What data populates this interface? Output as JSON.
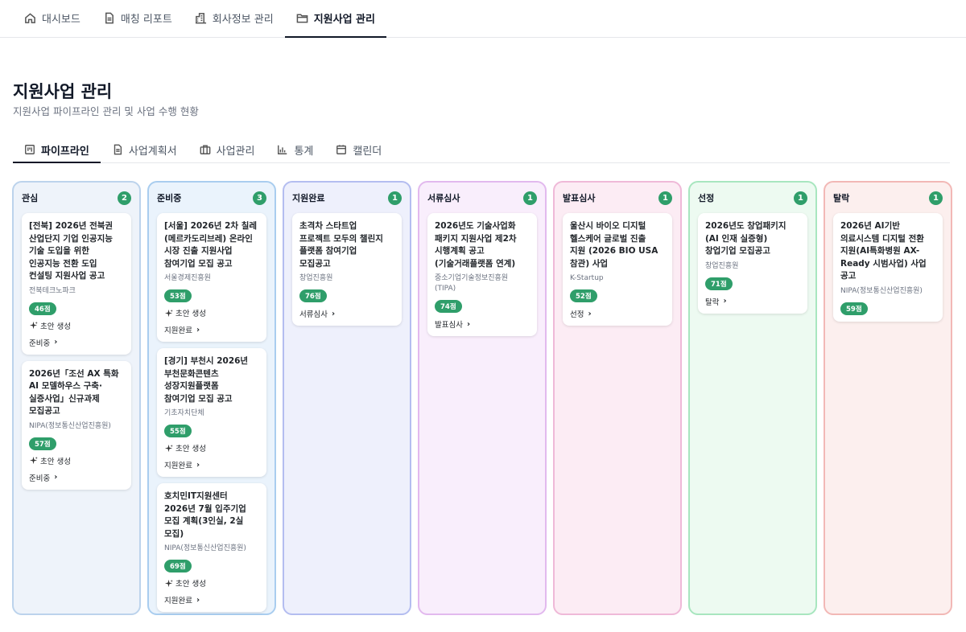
{
  "topnav": {
    "tabs": [
      {
        "label": "대시보드",
        "icon": "home-icon"
      },
      {
        "label": "매칭 리포트",
        "icon": "document-icon"
      },
      {
        "label": "회사정보 관리",
        "icon": "building-icon"
      },
      {
        "label": "지원사업 관리",
        "icon": "folder-icon",
        "active": true
      }
    ]
  },
  "page": {
    "title": "지원사업 관리",
    "subtitle": "지원사업 파이프라인 관리 및 사업 수행 현황"
  },
  "subtabs": [
    {
      "label": "파이프라인",
      "icon": "kanban-icon",
      "active": true
    },
    {
      "label": "사업계획서",
      "icon": "document-icon"
    },
    {
      "label": "사업관리",
      "icon": "briefcase-icon"
    },
    {
      "label": "통계",
      "icon": "bar-chart-icon"
    },
    {
      "label": "캘린더",
      "icon": "calendar-icon"
    }
  ],
  "colors": {
    "accent": "#2f9e6a"
  },
  "columns": [
    {
      "title": "관심",
      "count": "2",
      "border": "#bcd3ec",
      "bg": "#eef3fa",
      "cards": [
        {
          "title": "[전북] 2026년 전북권\n산업단지 기업 인공지능\n기술 도입을 위한\n인공지능 전환 도입\n컨설팅 지원사업 공고",
          "org": "전북테크노파크",
          "score": "46점",
          "draft": "초안 생성",
          "move": "준비중"
        },
        {
          "title": "2026년「조선 AX 특화\nAI 모델하우스 구축·\n실증사업」신규과제\n모집공고",
          "org": "NIPA(정보통신산업진흥원)",
          "score": "57점",
          "draft": "초안 생성",
          "move": "준비중"
        }
      ]
    },
    {
      "title": "준비중",
      "count": "3",
      "border": "#a9cdef",
      "bg": "#eaf3fc",
      "cards": [
        {
          "title": "[서울] 2026년 2차 칠레\n(메르카도리브레) 온라인\n시장 진출 지원사업\n참여기업 모집 공고",
          "org": "서울경제진흥원",
          "score": "53점",
          "draft": "초안 생성",
          "move": "지원완료"
        },
        {
          "title": "[경기] 부천시 2026년\n부천문화콘텐츠\n성장지원플랫폼\n참여기업 모집 공고",
          "org": "기초자치단체",
          "score": "55점",
          "draft": "초안 생성",
          "move": "지원완료"
        },
        {
          "title": "호치민IT지원센터\n2026년 7월 입주기업\n모집 계획(3인실, 2실\n모집)",
          "org": "NIPA(정보통신산업진흥원)",
          "score": "69점",
          "draft": "초안 생성",
          "move": "지원완료"
        }
      ]
    },
    {
      "title": "지원완료",
      "count": "1",
      "border": "#b4bdf0",
      "bg": "#eef0fc",
      "cards": [
        {
          "title": "초격차 스타트업\n프로젝트 모두의 챌린지\n플랫폼 참여기업\n모집공고",
          "org": "창업진흥원",
          "score": "76점",
          "move": "서류심사"
        }
      ]
    },
    {
      "title": "서류심사",
      "count": "1",
      "border": "#e2b9ee",
      "bg": "#f9eefc",
      "cards": [
        {
          "title": "2026년도 기술사업화\n패키지 지원사업 제2차\n시행계획 공고\n(기술거래플랫폼 연계)",
          "org": "중소기업기술정보진흥원\n(TIPA)",
          "score": "74점",
          "move": "발표심사"
        }
      ]
    },
    {
      "title": "발표심사",
      "count": "1",
      "border": "#efb9d8",
      "bg": "#fcecf4",
      "cards": [
        {
          "title": "울산시 바이오 디지털\n헬스케어 글로벌 진출\n지원 (2026 BIO USA\n참관) 사업",
          "org": "K-Startup",
          "score": "52점",
          "move": "선정"
        }
      ]
    },
    {
      "title": "선정",
      "count": "1",
      "border": "#a8e6bf",
      "bg": "#edfaf1",
      "cards": [
        {
          "title": "2026년도 창업패키지\n(AI 인재 실증형)\n창업기업 모집공고",
          "org": "창업진흥원",
          "score": "71점",
          "move": "탈락"
        }
      ]
    },
    {
      "title": "탈락",
      "count": "1",
      "border": "#f2b8b6",
      "bg": "#fcefee",
      "cards": [
        {
          "title": "2026년 AI기반\n의료시스템 디지털 전환\n지원(AI특화병원 AX-\nReady 시범사업) 사업\n공고",
          "org": "NIPA(정보통신산업진흥원)",
          "score": "59점"
        }
      ]
    }
  ]
}
